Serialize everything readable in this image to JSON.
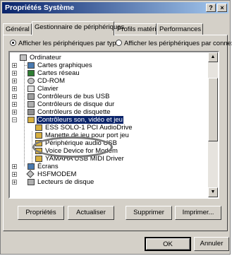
{
  "window": {
    "title": "Propriétés Système",
    "help_btn": "?",
    "close_btn": "×"
  },
  "tabs": [
    {
      "label": "Général"
    },
    {
      "label": "Gestionnaire de périphériques"
    },
    {
      "label": "Profils matériels"
    },
    {
      "label": "Performances"
    }
  ],
  "view_options": {
    "by_type": "Afficher les périphériques par type",
    "by_connection": "Afficher les périphériques par connexion",
    "selected": "by_type"
  },
  "tree": {
    "root": "Ordinateur",
    "items": [
      {
        "label": "Cartes graphiques",
        "icon": "display-adapter-icon"
      },
      {
        "label": "Cartes réseau",
        "icon": "network-card-icon"
      },
      {
        "label": "CD-ROM",
        "icon": "cdrom-icon"
      },
      {
        "label": "Clavier",
        "icon": "keyboard-icon"
      },
      {
        "label": "Contrôleurs de bus USB",
        "icon": "usb-icon"
      },
      {
        "label": "Contrôleurs de disque dur",
        "icon": "harddisk-icon"
      },
      {
        "label": "Contrôleurs de disquette",
        "icon": "floppy-icon"
      },
      {
        "label": "Contrôleurs son, vidéo et jeu",
        "icon": "sound-icon",
        "selected": true
      },
      {
        "label": "ESS SOLO-1 PCI AudioDrive",
        "icon": "sound-device-icon"
      },
      {
        "label": "Manette de jeu pour port jeu",
        "icon": "sound-device-icon"
      },
      {
        "label": "Périphérique audio USB",
        "icon": "sound-device-icon",
        "highlighted": true
      },
      {
        "label": "Voice Device for Modem",
        "icon": "sound-device-icon"
      },
      {
        "label": "YAMAHA USB MIDI Driver",
        "icon": "sound-device-icon"
      },
      {
        "label": "Écrans",
        "icon": "monitor-icon"
      },
      {
        "label": "HSFMODEM",
        "icon": "modem-icon"
      },
      {
        "label": "Lecteurs de disque",
        "icon": "disk-drive-icon"
      }
    ]
  },
  "actions": {
    "properties": "Propriétés",
    "refresh": "Actualiser",
    "remove": "Supprimer",
    "print": "Imprimer..."
  },
  "footer": {
    "ok": "OK",
    "cancel": "Annuler"
  },
  "colors": {
    "selection": "#0a246a",
    "face": "#d4d0c8",
    "titlebar_start": "#0a246a",
    "titlebar_end": "#a6caf0"
  }
}
